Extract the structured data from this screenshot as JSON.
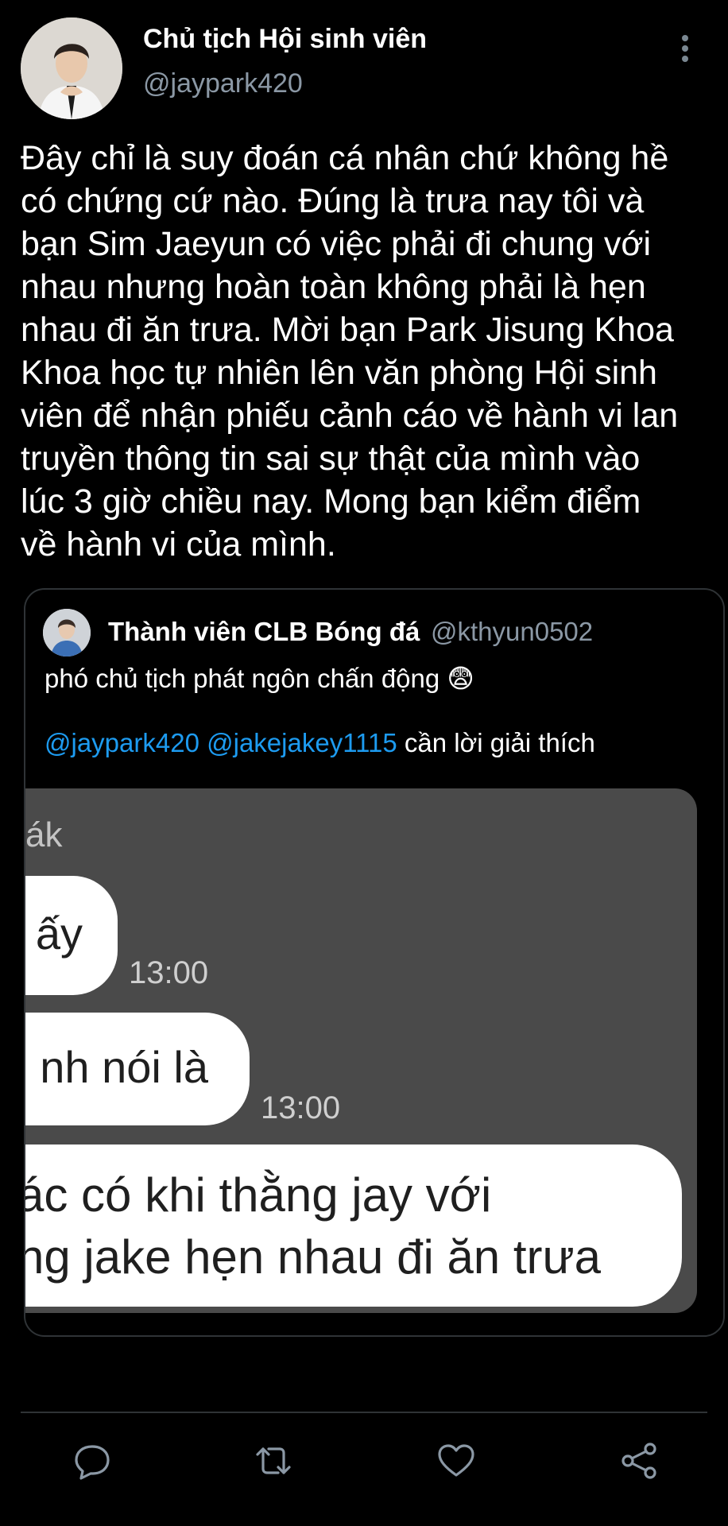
{
  "author": {
    "display_name": "Chủ tịch Hội sinh viên",
    "handle": "@jaypark420"
  },
  "tweet": {
    "lines": [
      "Đây chỉ là suy đoán cá nhân chứ không hề",
      "có chứng cứ nào. Đúng là trưa nay tôi và",
      "bạn Sim Jaeyun có việc phải đi chung với",
      "nhau nhưng hoàn toàn không phải là hẹn",
      "nhau đi ăn trưa. Mời bạn Park Jisung Khoa",
      "Khoa học tự nhiên lên văn phòng Hội sinh",
      "viên để nhận phiếu cảnh cáo về hành vi lan",
      "truyền thông tin sai sự thật của mình vào",
      "lúc 3 giờ chiều nay. Mong bạn kiểm điểm",
      "về hành vi của mình."
    ]
  },
  "quoted": {
    "display_name": "Thành viên CLB Bóng đá",
    "handle": "@kthyun0502",
    "text": "phó chủ tịch phát ngôn chấn động 😨",
    "mention1": "@jaypark420",
    "mention2": "@jakejakey1115",
    "text_after_mentions": "cần lời giải thích",
    "media": {
      "top_text": "ák",
      "bubble1": "ấy",
      "time1": "13:00",
      "bubble2": "nh nói là",
      "time2": "13:00",
      "bubble3_line1": "ác có khi thằng jay với",
      "bubble3_line2": "ng jake hẹn nhau đi ăn trưa"
    }
  },
  "actions": {
    "icons": [
      "reply-icon",
      "retweet-icon",
      "like-icon",
      "share-icon"
    ],
    "icon_color": "#8b98a5"
  }
}
